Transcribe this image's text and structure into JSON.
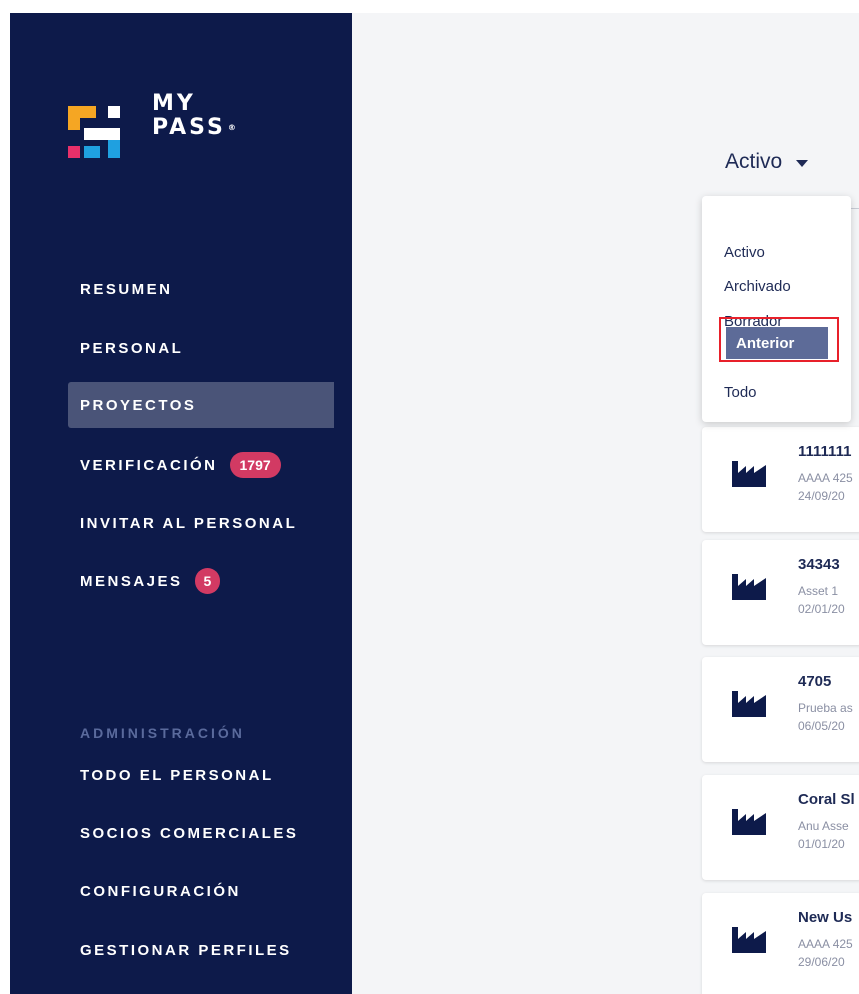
{
  "logo": {
    "line1": "MY",
    "line2": "PASS",
    "reg": "®"
  },
  "nav": {
    "resumen": "RESUMEN",
    "personal": "PERSONAL",
    "proyectos": "PROYECTOS",
    "verificacion": "VERIFICACIÓN",
    "verificacion_badge": "1797",
    "invitar": "INVITAR AL PERSONAL",
    "mensajes": "MENSAJES",
    "mensajes_badge": "5"
  },
  "admin": {
    "heading": "ADMINISTRACIÓN",
    "todo_personal": "TODO EL PERSONAL",
    "socios": "SOCIOS COMERCIALES",
    "configuracion": "CONFIGURACIÓN",
    "perfiles": "GESTIONAR PERFILES"
  },
  "filter": {
    "selected": "Activo",
    "options": [
      "Activo",
      "Archivado",
      "Borrador",
      "Anterior",
      "Todo"
    ],
    "highlighted": "Anterior"
  },
  "projects": [
    {
      "title": "1111111",
      "sub": "AAAA 425",
      "date": "24/09/20"
    },
    {
      "title": "34343",
      "sub": "Asset 1",
      "date": "02/01/20"
    },
    {
      "title": "4705",
      "sub": "Prueba as",
      "date": "06/05/20"
    },
    {
      "title": "Coral Sl",
      "sub": "Anu Asse",
      "date": "01/01/20"
    },
    {
      "title": "New Us",
      "sub": "AAAA 425",
      "date": "29/06/20"
    }
  ],
  "colors": {
    "sidebar": "#0d1a4a",
    "active_nav": "#4a5478",
    "badge": "#d23a63",
    "highlight_box": "#e8202a"
  },
  "icons": {
    "project": "factory-icon",
    "caret": "caret-down-icon"
  }
}
